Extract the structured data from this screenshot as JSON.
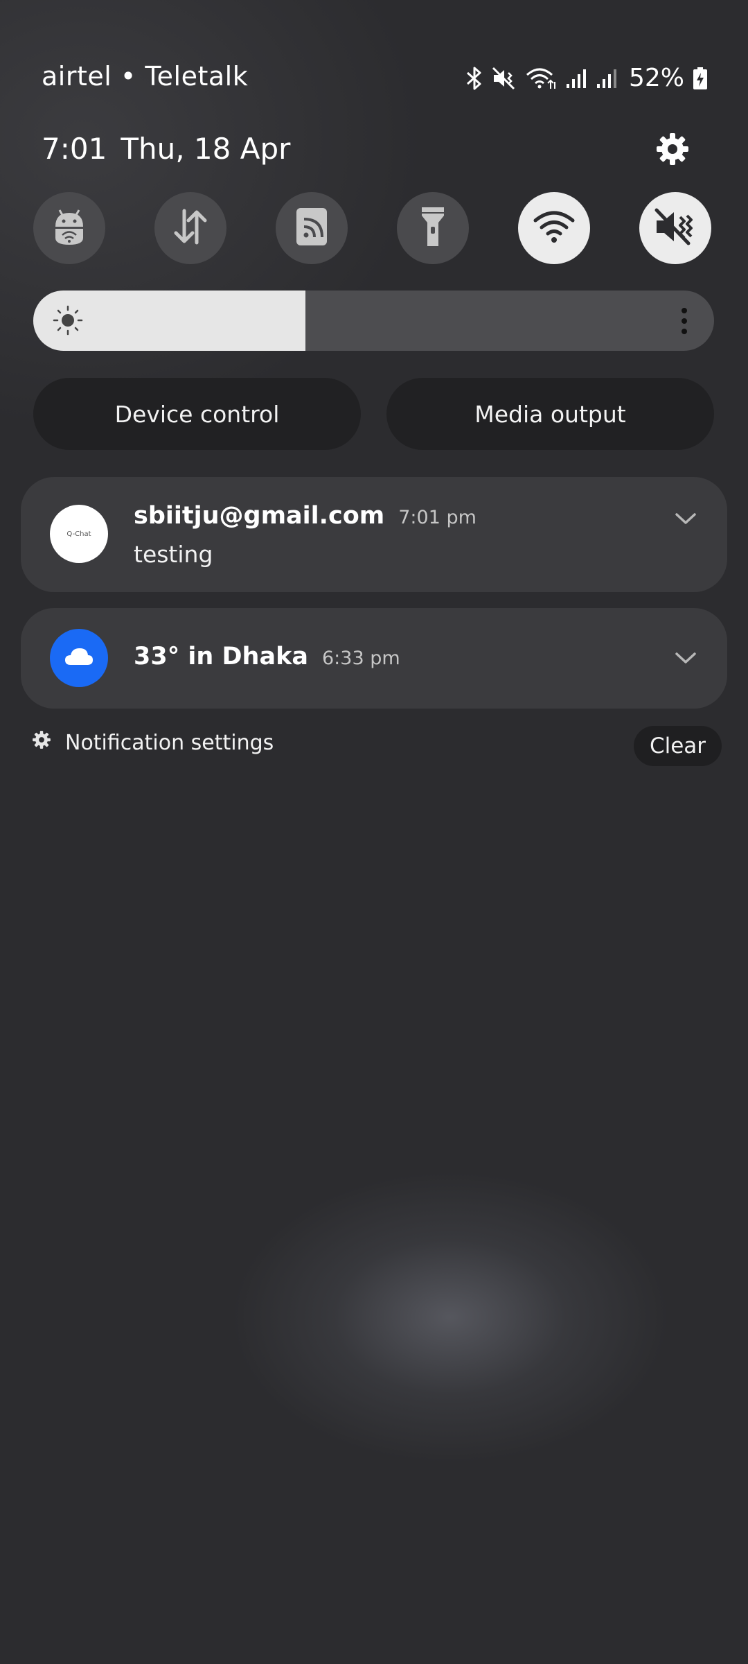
{
  "status_bar": {
    "carrier": "airtel • Teletalk",
    "battery": "52%",
    "icons": [
      "bluetooth-icon",
      "vibrate-mute-icon",
      "wifi-icon",
      "signal-sim1-icon",
      "signal-sim2-icon",
      "battery-charging-icon"
    ]
  },
  "header": {
    "time": "7:01",
    "date": "Thu, 18 Apr",
    "settings_icon": "gear-icon"
  },
  "quick_tiles": [
    {
      "name": "android-debug",
      "icon": "android-icon",
      "active": false
    },
    {
      "name": "mobile-data",
      "icon": "data-transfer-icon",
      "active": false
    },
    {
      "name": "nfc",
      "icon": "nfc-icon",
      "active": false
    },
    {
      "name": "flashlight",
      "icon": "flashlight-icon",
      "active": false
    },
    {
      "name": "wifi",
      "icon": "wifi-icon",
      "active": true
    },
    {
      "name": "sound",
      "icon": "mute-icon",
      "active": true
    }
  ],
  "brightness": {
    "level": 0.4
  },
  "buttons": {
    "device_control": "Device control",
    "media_output": "Media output"
  },
  "notifications": [
    {
      "app_badge": "Q-Chat",
      "title": "sbiitju@gmail.com",
      "time": "7:01 pm",
      "body": "testing"
    },
    {
      "app_icon": "cloud-icon",
      "title": "33° in Dhaka",
      "time": "6:33 pm"
    }
  ],
  "footer": {
    "notification_settings": "Notification settings",
    "clear": "Clear"
  },
  "colors": {
    "background": "#2c2c2f",
    "tile_off": "#4a4a4d",
    "tile_on": "#ececec",
    "card": "#3b3b3e",
    "weather_accent": "#1a6af5"
  }
}
